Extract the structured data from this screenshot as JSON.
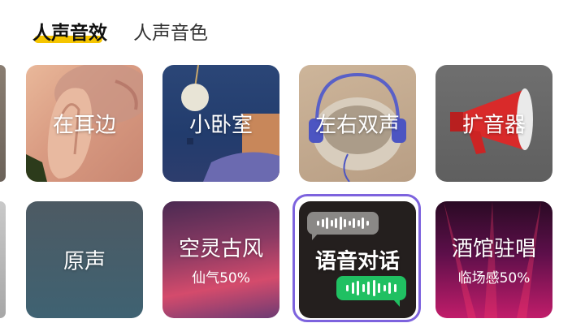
{
  "tabs": [
    {
      "label": "人声音效",
      "active": true
    },
    {
      "label": "人声音色",
      "active": false
    }
  ],
  "colors": {
    "tab_highlight": "#f5c500",
    "selected_border": "#7d63de",
    "voice_bubble_green": "#20c062"
  },
  "effects_row1": [
    {
      "label": "在耳边",
      "icon": "whisper-ear-photo"
    },
    {
      "label": "小卧室",
      "icon": "bedroom-photo"
    },
    {
      "label": "左右双声",
      "icon": "headphones-photo"
    },
    {
      "label": "扩音器",
      "icon": "megaphone-photo"
    }
  ],
  "effects_row2": [
    {
      "label": "原声"
    },
    {
      "label": "空灵古风",
      "sub": "仙气50%"
    },
    {
      "label": "语音对话",
      "selected": true,
      "icon": "voice-message-bubbles"
    },
    {
      "label": "酒馆驻唱",
      "sub": "临场感50%"
    }
  ]
}
